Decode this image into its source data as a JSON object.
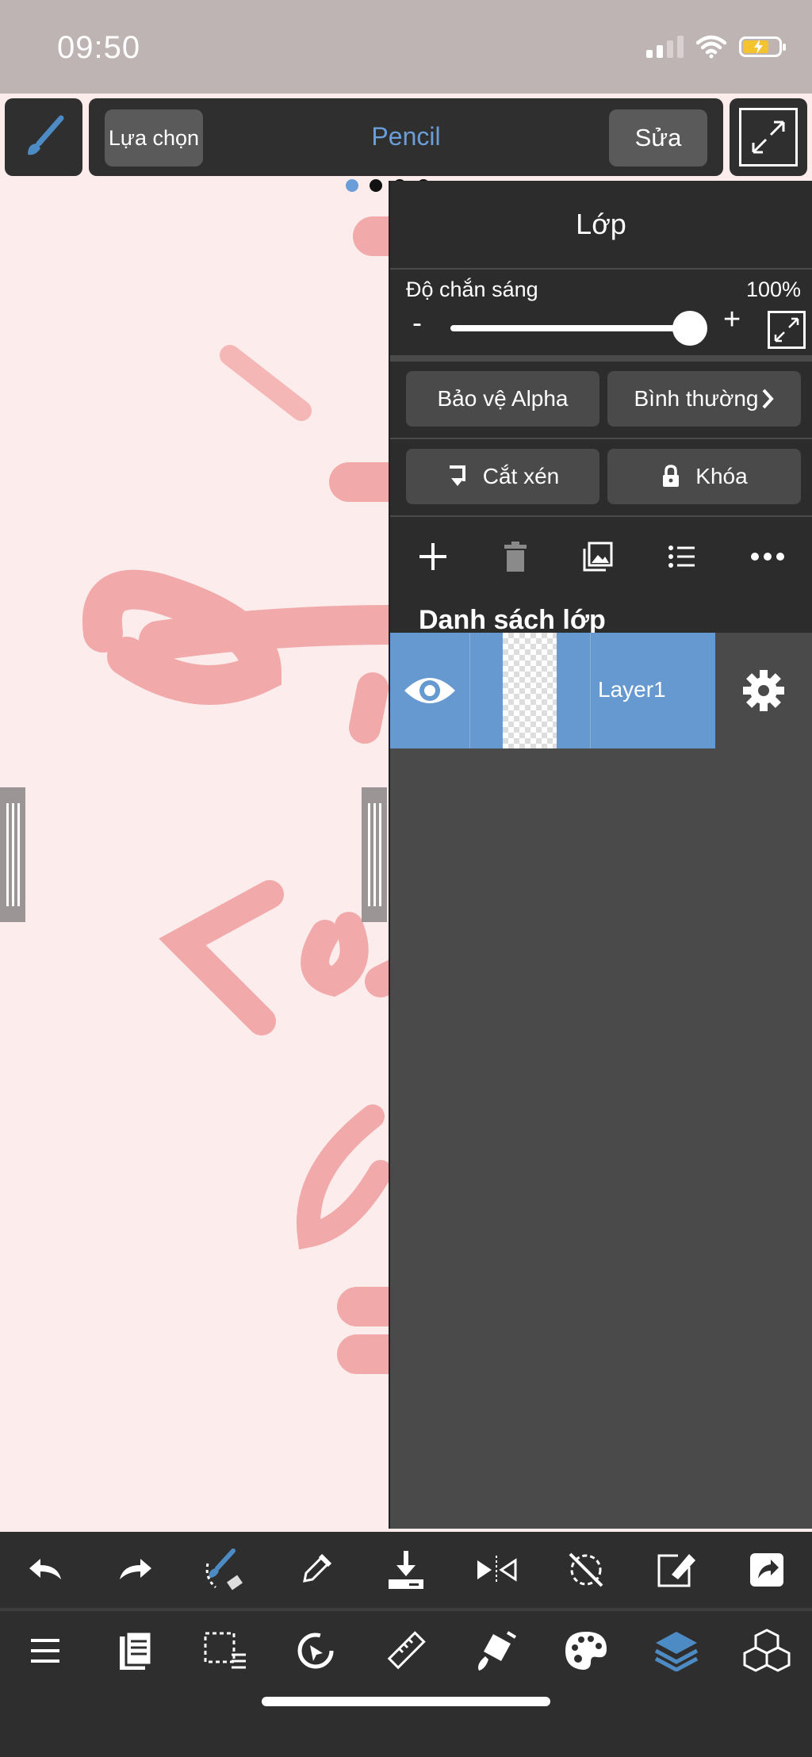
{
  "status": {
    "time": "09:50"
  },
  "toolbar": {
    "select_label": "Lựa chọn",
    "tool_name": "Pencil",
    "edit_label": "Sửa"
  },
  "layers_panel": {
    "title": "Lớp",
    "opacity_label": "Độ chắn sáng",
    "opacity_value": "100%",
    "opacity_level": 1.0,
    "minus_label": "-",
    "plus_label": "+",
    "alpha_protect_label": "Bảo vệ Alpha",
    "blend_mode_label": "Bình thường",
    "clipping_label": "Cắt xén",
    "lock_label": "Khóa",
    "list_title": "Danh sách lớp",
    "layers": [
      {
        "name": "Layer1",
        "visible": true,
        "selected": true
      }
    ]
  },
  "icons": {
    "bottom_row1": [
      "undo-icon",
      "redo-icon",
      "brush-transform-icon",
      "eyedropper-icon",
      "save-icon",
      "flip-icon",
      "rotate-reset-icon",
      "edit-icon",
      "share-icon"
    ],
    "bottom_row2": [
      "menu-icon",
      "pages-icon",
      "selection-icon",
      "transform-icon",
      "ruler-icon",
      "fill-icon",
      "palette-icon",
      "layers-icon",
      "materials-icon"
    ]
  },
  "colors": {
    "accent": "#6b9ed8",
    "layer_selected": "#6599cf",
    "canvas": "#fdecec",
    "stroke": "#f2a9a9"
  }
}
